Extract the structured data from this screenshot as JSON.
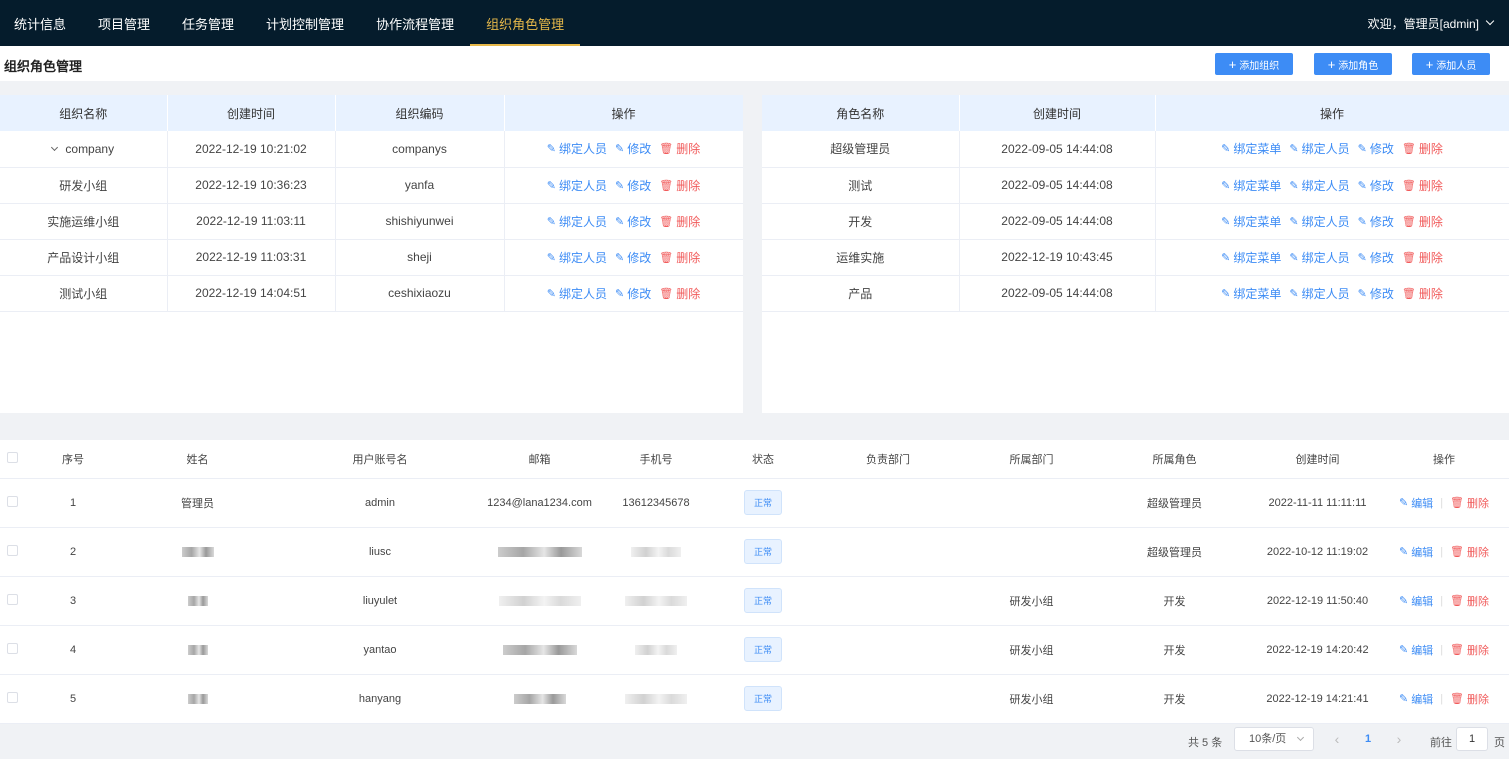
{
  "nav": {
    "items": [
      {
        "label": "统计信息"
      },
      {
        "label": "项目管理"
      },
      {
        "label": "任务管理"
      },
      {
        "label": "计划控制管理"
      },
      {
        "label": "协作流程管理"
      },
      {
        "label": "组织角色管理"
      }
    ],
    "active_index": 5,
    "user_greeting": "欢迎，管理员[admin]"
  },
  "header": {
    "title": "组织角色管理",
    "buttons": {
      "add_org": "添加组织",
      "add_role": "添加角色",
      "add_member": "添加人员"
    }
  },
  "org_table": {
    "columns": [
      "组织名称",
      "创建时间",
      "组织编码",
      "操作"
    ],
    "rows": [
      {
        "name": "company",
        "created": "2022-12-19 10:21:02",
        "code": "companys",
        "expanded": true
      },
      {
        "name": "研发小组",
        "created": "2022-12-19 10:36:23",
        "code": "yanfa"
      },
      {
        "name": "实施运维小组",
        "created": "2022-12-19 11:03:11",
        "code": "shishiyunwei"
      },
      {
        "name": "产品设计小组",
        "created": "2022-12-19 11:03:31",
        "code": "sheji"
      },
      {
        "name": "测试小组",
        "created": "2022-12-19 14:04:51",
        "code": "ceshixiaozu"
      }
    ],
    "actions": {
      "bind_member": "绑定人员",
      "edit": "修改",
      "delete": "删除"
    }
  },
  "role_table": {
    "columns": [
      "角色名称",
      "创建时间",
      "操作"
    ],
    "rows": [
      {
        "name": "超级管理员",
        "created": "2022-09-05 14:44:08"
      },
      {
        "name": "测试",
        "created": "2022-09-05 14:44:08"
      },
      {
        "name": "开发",
        "created": "2022-09-05 14:44:08"
      },
      {
        "name": "运维实施",
        "created": "2022-12-19 10:43:45"
      },
      {
        "name": "产品",
        "created": "2022-09-05 14:44:08"
      }
    ],
    "actions": {
      "bind_menu": "绑定菜单",
      "bind_member": "绑定人员",
      "edit": "修改",
      "delete": "删除"
    }
  },
  "user_table": {
    "columns": [
      "序号",
      "姓名",
      "用户账号名",
      "邮箱",
      "手机号",
      "状态",
      "负责部门",
      "所属部门",
      "所属角色",
      "创建时间",
      "操作"
    ],
    "rows": [
      {
        "index": "1",
        "name": "管理员",
        "account": "admin",
        "email": "1234@lana1234.com",
        "phone": "13612345678",
        "status": "正常",
        "resp_dept": "",
        "dept": "",
        "role": "超级管理员",
        "created": "2022-11-11 11:11:11",
        "redacted": false
      },
      {
        "index": "2",
        "name": "",
        "account": "liusc",
        "email": "",
        "phone": "",
        "status": "正常",
        "resp_dept": "",
        "dept": "",
        "role": "超级管理员",
        "created": "2022-10-12 11:19:02",
        "redacted": true
      },
      {
        "index": "3",
        "name": "",
        "account": "liuyulet",
        "email": "",
        "phone": "",
        "status": "正常",
        "resp_dept": "",
        "dept": "研发小组",
        "role": "开发",
        "created": "2022-12-19 11:50:40",
        "redacted": true
      },
      {
        "index": "4",
        "name": "",
        "account": "yantao",
        "email": "",
        "phone": "",
        "status": "正常",
        "resp_dept": "",
        "dept": "研发小组",
        "role": "开发",
        "created": "2022-12-19 14:20:42",
        "redacted": true
      },
      {
        "index": "5",
        "name": "",
        "account": "hanyang",
        "email": "",
        "phone": "",
        "status": "正常",
        "resp_dept": "",
        "dept": "研发小组",
        "role": "开发",
        "created": "2022-12-19 14:21:41",
        "redacted": true
      }
    ],
    "actions": {
      "edit": "编辑",
      "delete": "删除"
    }
  },
  "pagination": {
    "total": "共 5 条",
    "page_size": "10条/页",
    "current": "1",
    "goto_label": "前往",
    "goto_value": "1",
    "page_suffix": "页"
  },
  "colors": {
    "nav_bg": "#051c2c",
    "accent": "#e6b84a",
    "primary": "#3d8cf5",
    "danger": "#f15a5a"
  },
  "icons": [
    "chevron-down-icon",
    "plus-icon",
    "edit-icon",
    "trash-icon",
    "chevron-left-icon",
    "chevron-right-icon"
  ]
}
